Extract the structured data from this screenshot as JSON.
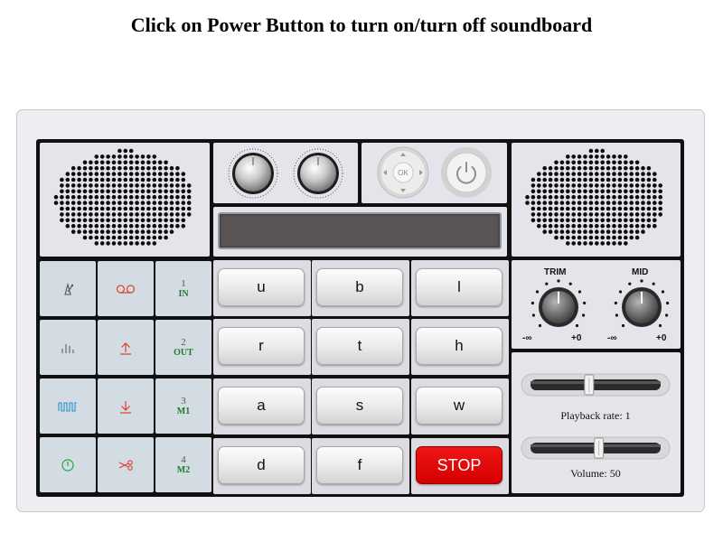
{
  "page": {
    "title": "Click on Power Button to turn on/turn off soundboard"
  },
  "nav": {
    "ok_label": "OK"
  },
  "eq": {
    "trim_label": "TRIM",
    "mid_label": "MID",
    "scale_min": "-∞",
    "scale_max": "+0"
  },
  "tools": [
    {
      "icon": "metronome-icon",
      "color": "#555555"
    },
    {
      "icon": "voicemail-icon",
      "color": "#e0402a"
    },
    {
      "number": "1",
      "label": "IN"
    },
    {
      "icon": "equalizer-bars-icon",
      "color": "#555555"
    },
    {
      "icon": "upload-icon",
      "color": "#e0402a"
    },
    {
      "number": "2",
      "label": "OUT"
    },
    {
      "icon": "square-wave-icon",
      "color": "#2a8fd0"
    },
    {
      "icon": "download-icon",
      "color": "#e0402a"
    },
    {
      "number": "3",
      "label": "M1"
    },
    {
      "icon": "power-circle-icon",
      "color": "#25a645"
    },
    {
      "icon": "scissors-icon",
      "color": "#e0402a"
    },
    {
      "number": "4",
      "label": "M2"
    }
  ],
  "keys": [
    "u",
    "b",
    "l",
    "r",
    "t",
    "h",
    "a",
    "s",
    "w",
    "d",
    "f",
    "STOP"
  ],
  "sliders": {
    "playback": {
      "caption": "Playback rate: 1",
      "value": 1,
      "position_fraction": 0.5
    },
    "volume": {
      "caption": "Volume: 50",
      "value": 50,
      "position_fraction": 0.5
    }
  },
  "colors": {
    "stop_button": "#dd0000",
    "display_bg": "#5a5554",
    "panel": "#e4e4ea",
    "tool_cell": "#d3dbe3"
  }
}
